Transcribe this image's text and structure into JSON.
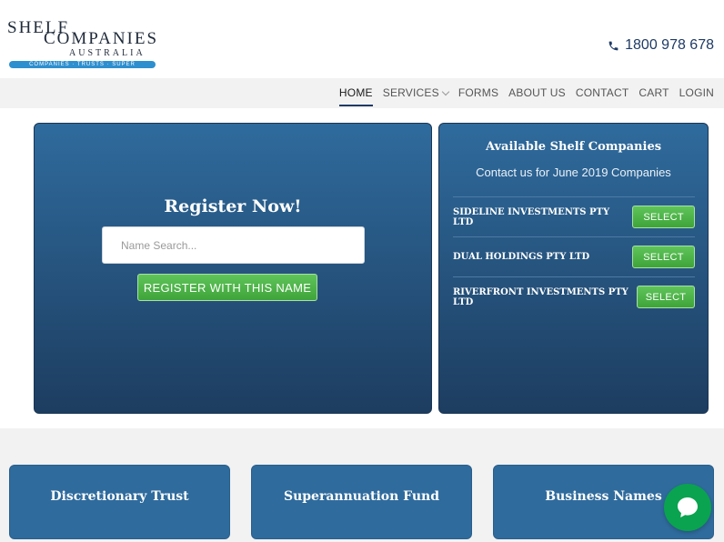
{
  "logo": {
    "line1": "SHELF",
    "line2": "COMPANIES",
    "line3": "AUSTRALIA",
    "tagline": "COMPANIES · TRUSTS · SUPER"
  },
  "header": {
    "phone": "1800 978 678"
  },
  "nav": {
    "home": "HOME",
    "services": "SERVICES",
    "forms": "FORMS",
    "about": "ABOUT US",
    "contact": "CONTACT",
    "cart": "CART",
    "login": "LOGIN"
  },
  "register": {
    "title": "Register Now!",
    "placeholder": "Name Search...",
    "button": "REGISTER WITH THIS NAME"
  },
  "available": {
    "title": "Available Shelf Companies",
    "subtitle": "Contact us for June 2019 Companies",
    "companies": [
      {
        "name": "SIDELINE INVESTMENTS PTY LTD",
        "button": "SELECT"
      },
      {
        "name": "DUAL HOLDINGS PTY LTD",
        "button": "SELECT"
      },
      {
        "name": "RIVERFRONT INVESTMENTS PTY LTD",
        "button": "SELECT"
      }
    ]
  },
  "cards": [
    "Discretionary Trust",
    "Superannuation Fund",
    "Business Names"
  ],
  "colors": {
    "brand_blue": "#2f6b9d",
    "accent_green": "#4bb446",
    "chat_green": "#0aa34f"
  }
}
